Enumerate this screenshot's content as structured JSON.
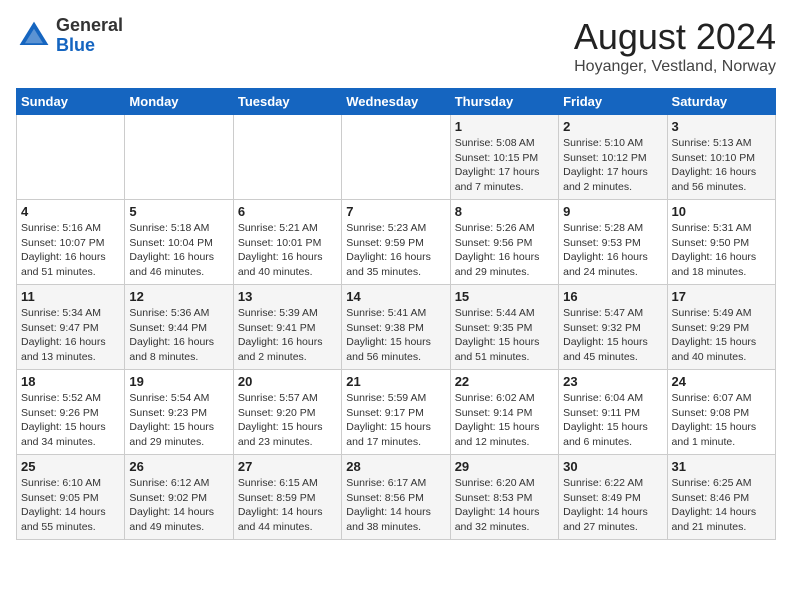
{
  "header": {
    "logo_general": "General",
    "logo_blue": "Blue",
    "title": "August 2024",
    "subtitle": "Hoyanger, Vestland, Norway"
  },
  "weekdays": [
    "Sunday",
    "Monday",
    "Tuesday",
    "Wednesday",
    "Thursday",
    "Friday",
    "Saturday"
  ],
  "weeks": [
    [
      {
        "day": "",
        "info": ""
      },
      {
        "day": "",
        "info": ""
      },
      {
        "day": "",
        "info": ""
      },
      {
        "day": "",
        "info": ""
      },
      {
        "day": "1",
        "info": "Sunrise: 5:08 AM\nSunset: 10:15 PM\nDaylight: 17 hours\nand 7 minutes."
      },
      {
        "day": "2",
        "info": "Sunrise: 5:10 AM\nSunset: 10:12 PM\nDaylight: 17 hours\nand 2 minutes."
      },
      {
        "day": "3",
        "info": "Sunrise: 5:13 AM\nSunset: 10:10 PM\nDaylight: 16 hours\nand 56 minutes."
      }
    ],
    [
      {
        "day": "4",
        "info": "Sunrise: 5:16 AM\nSunset: 10:07 PM\nDaylight: 16 hours\nand 51 minutes."
      },
      {
        "day": "5",
        "info": "Sunrise: 5:18 AM\nSunset: 10:04 PM\nDaylight: 16 hours\nand 46 minutes."
      },
      {
        "day": "6",
        "info": "Sunrise: 5:21 AM\nSunset: 10:01 PM\nDaylight: 16 hours\nand 40 minutes."
      },
      {
        "day": "7",
        "info": "Sunrise: 5:23 AM\nSunset: 9:59 PM\nDaylight: 16 hours\nand 35 minutes."
      },
      {
        "day": "8",
        "info": "Sunrise: 5:26 AM\nSunset: 9:56 PM\nDaylight: 16 hours\nand 29 minutes."
      },
      {
        "day": "9",
        "info": "Sunrise: 5:28 AM\nSunset: 9:53 PM\nDaylight: 16 hours\nand 24 minutes."
      },
      {
        "day": "10",
        "info": "Sunrise: 5:31 AM\nSunset: 9:50 PM\nDaylight: 16 hours\nand 18 minutes."
      }
    ],
    [
      {
        "day": "11",
        "info": "Sunrise: 5:34 AM\nSunset: 9:47 PM\nDaylight: 16 hours\nand 13 minutes."
      },
      {
        "day": "12",
        "info": "Sunrise: 5:36 AM\nSunset: 9:44 PM\nDaylight: 16 hours\nand 8 minutes."
      },
      {
        "day": "13",
        "info": "Sunrise: 5:39 AM\nSunset: 9:41 PM\nDaylight: 16 hours\nand 2 minutes."
      },
      {
        "day": "14",
        "info": "Sunrise: 5:41 AM\nSunset: 9:38 PM\nDaylight: 15 hours\nand 56 minutes."
      },
      {
        "day": "15",
        "info": "Sunrise: 5:44 AM\nSunset: 9:35 PM\nDaylight: 15 hours\nand 51 minutes."
      },
      {
        "day": "16",
        "info": "Sunrise: 5:47 AM\nSunset: 9:32 PM\nDaylight: 15 hours\nand 45 minutes."
      },
      {
        "day": "17",
        "info": "Sunrise: 5:49 AM\nSunset: 9:29 PM\nDaylight: 15 hours\nand 40 minutes."
      }
    ],
    [
      {
        "day": "18",
        "info": "Sunrise: 5:52 AM\nSunset: 9:26 PM\nDaylight: 15 hours\nand 34 minutes."
      },
      {
        "day": "19",
        "info": "Sunrise: 5:54 AM\nSunset: 9:23 PM\nDaylight: 15 hours\nand 29 minutes."
      },
      {
        "day": "20",
        "info": "Sunrise: 5:57 AM\nSunset: 9:20 PM\nDaylight: 15 hours\nand 23 minutes."
      },
      {
        "day": "21",
        "info": "Sunrise: 5:59 AM\nSunset: 9:17 PM\nDaylight: 15 hours\nand 17 minutes."
      },
      {
        "day": "22",
        "info": "Sunrise: 6:02 AM\nSunset: 9:14 PM\nDaylight: 15 hours\nand 12 minutes."
      },
      {
        "day": "23",
        "info": "Sunrise: 6:04 AM\nSunset: 9:11 PM\nDaylight: 15 hours\nand 6 minutes."
      },
      {
        "day": "24",
        "info": "Sunrise: 6:07 AM\nSunset: 9:08 PM\nDaylight: 15 hours\nand 1 minute."
      }
    ],
    [
      {
        "day": "25",
        "info": "Sunrise: 6:10 AM\nSunset: 9:05 PM\nDaylight: 14 hours\nand 55 minutes."
      },
      {
        "day": "26",
        "info": "Sunrise: 6:12 AM\nSunset: 9:02 PM\nDaylight: 14 hours\nand 49 minutes."
      },
      {
        "day": "27",
        "info": "Sunrise: 6:15 AM\nSunset: 8:59 PM\nDaylight: 14 hours\nand 44 minutes."
      },
      {
        "day": "28",
        "info": "Sunrise: 6:17 AM\nSunset: 8:56 PM\nDaylight: 14 hours\nand 38 minutes."
      },
      {
        "day": "29",
        "info": "Sunrise: 6:20 AM\nSunset: 8:53 PM\nDaylight: 14 hours\nand 32 minutes."
      },
      {
        "day": "30",
        "info": "Sunrise: 6:22 AM\nSunset: 8:49 PM\nDaylight: 14 hours\nand 27 minutes."
      },
      {
        "day": "31",
        "info": "Sunrise: 6:25 AM\nSunset: 8:46 PM\nDaylight: 14 hours\nand 21 minutes."
      }
    ]
  ]
}
